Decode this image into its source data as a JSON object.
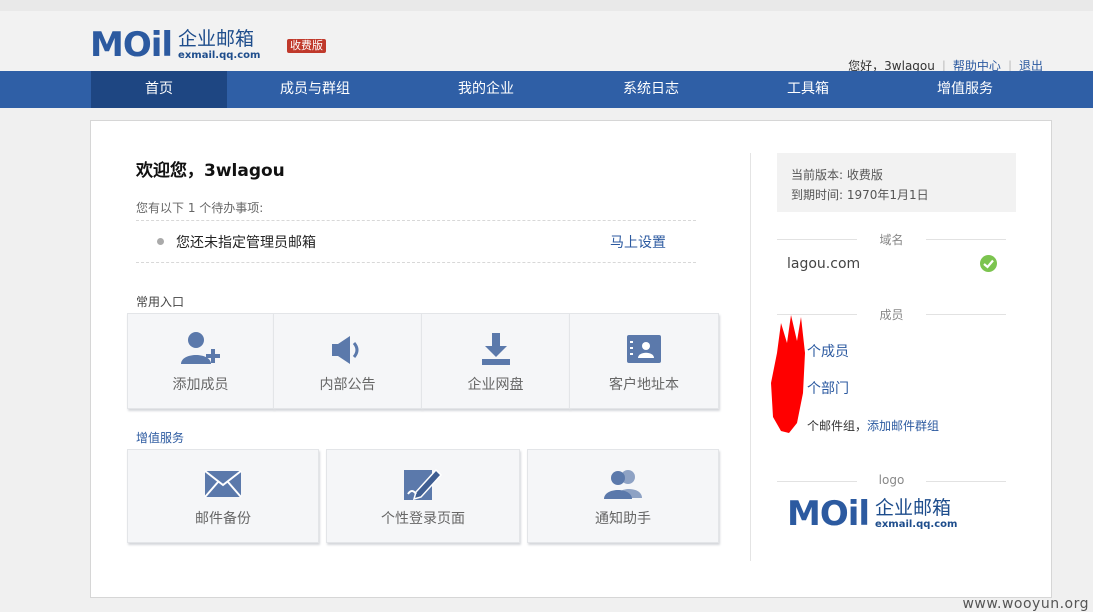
{
  "header": {
    "logo_word": "MOil",
    "logo_cn": "企业邮箱",
    "logo_url": "exmail.qq.com",
    "edition_tag": "收费版",
    "greeting": "您好，3wlagou",
    "help_link": "帮助中心",
    "logout_link": "退出"
  },
  "nav": {
    "items": [
      {
        "label": "首页",
        "active": true
      },
      {
        "label": "成员与群组",
        "active": false
      },
      {
        "label": "我的企业",
        "active": false
      },
      {
        "label": "系统日志",
        "active": false
      },
      {
        "label": "工具箱",
        "active": false
      },
      {
        "label": "增值服务",
        "active": false
      }
    ]
  },
  "main": {
    "welcome": "欢迎您，3wlagou",
    "todo_title": "您有以下 1 个待办事项:",
    "todo_item": "您还未指定管理员邮箱",
    "todo_action": "马上设置",
    "common_title": "常用入口",
    "common_entries": [
      {
        "label": "添加成员",
        "icon": "add-user-icon"
      },
      {
        "label": "内部公告",
        "icon": "speaker-icon"
      },
      {
        "label": "企业网盘",
        "icon": "download-icon"
      },
      {
        "label": "客户地址本",
        "icon": "contact-card-icon"
      }
    ],
    "value_title": "增值服务",
    "value_entries": [
      {
        "label": "邮件备份",
        "icon": "envelope-icon"
      },
      {
        "label": "个性登录页面",
        "icon": "edit-page-icon"
      },
      {
        "label": "通知助手",
        "icon": "users-icon"
      }
    ]
  },
  "sidebar": {
    "version_line": "当前版本: 收费版",
    "expire_line": "到期时间: 1970年1月1日",
    "domain_title": "域名",
    "domain": "lagou.com",
    "members_title": "成员",
    "member_count_text": "个成员",
    "department_text": "个部门",
    "mailgroup_text": "个邮件组，",
    "add_mailgroup": "添加邮件群组",
    "logo_title": "logo"
  },
  "watermark": "www.wooyun.org",
  "colors": {
    "nav": "#2f5fa6",
    "nav_active": "#1e4682",
    "link": "#2c5aa0",
    "check": "#7cc44f",
    "tag": "#c0392b"
  }
}
